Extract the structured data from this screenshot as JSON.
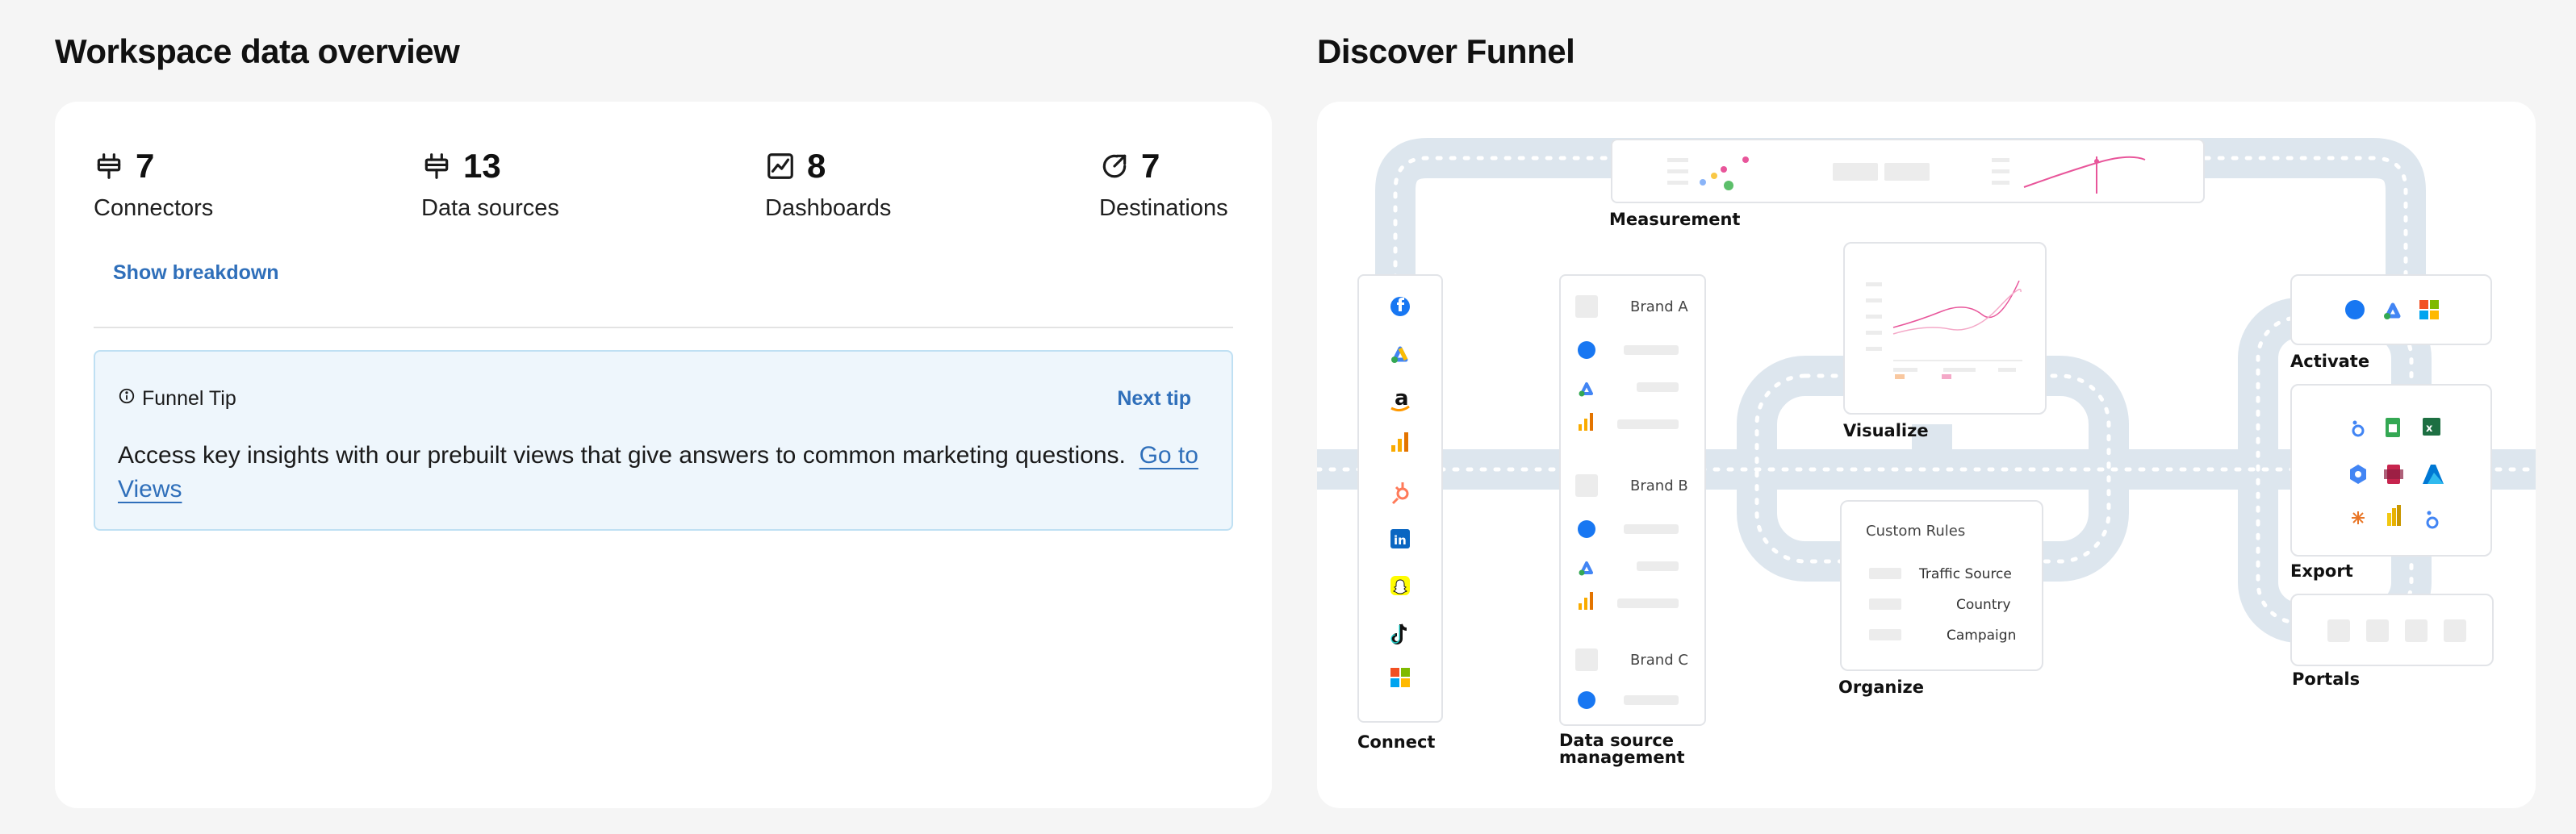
{
  "overview": {
    "title": "Workspace data overview",
    "stats": [
      {
        "icon": "plug-icon",
        "value": "7",
        "label": "Connectors"
      },
      {
        "icon": "plug-icon",
        "value": "13",
        "label": "Data sources"
      },
      {
        "icon": "dashboard-chart-icon",
        "value": "8",
        "label": "Dashboards"
      },
      {
        "icon": "destination-arrow-icon",
        "value": "7",
        "label": "Destinations"
      }
    ],
    "breakdown_label": "Show breakdown",
    "tip": {
      "icon": "info-icon",
      "title": "Funnel Tip",
      "next_label": "Next tip",
      "body": "Access key insights with our prebuilt views that give answers to common marketing questions.",
      "link_label": "Go to Views"
    }
  },
  "funnel": {
    "title": "Discover Funnel",
    "labels": {
      "measurement": "Measurement",
      "connect": "Connect",
      "data_source_management": "Data source management",
      "visualize": "Visualize",
      "organize": "Organize",
      "activate": "Activate",
      "export": "Export",
      "portals": "Portals"
    },
    "brands": [
      "Brand A",
      "Brand B",
      "Brand C"
    ],
    "custom_rules": {
      "title": "Custom Rules",
      "items": [
        "Traffic Source",
        "Country",
        "Campaign"
      ]
    },
    "connect_icons": [
      "facebook-icon",
      "google-ads-icon",
      "amazon-icon",
      "google-analytics-icon",
      "hubspot-icon",
      "linkedin-icon",
      "snapchat-icon",
      "tiktok-icon",
      "microsoft-icon"
    ],
    "colors": {
      "road": "#dde6ee",
      "road_dash": "#ffffff",
      "accent": "#2f6fba",
      "chart_line": "#e8559a"
    }
  }
}
